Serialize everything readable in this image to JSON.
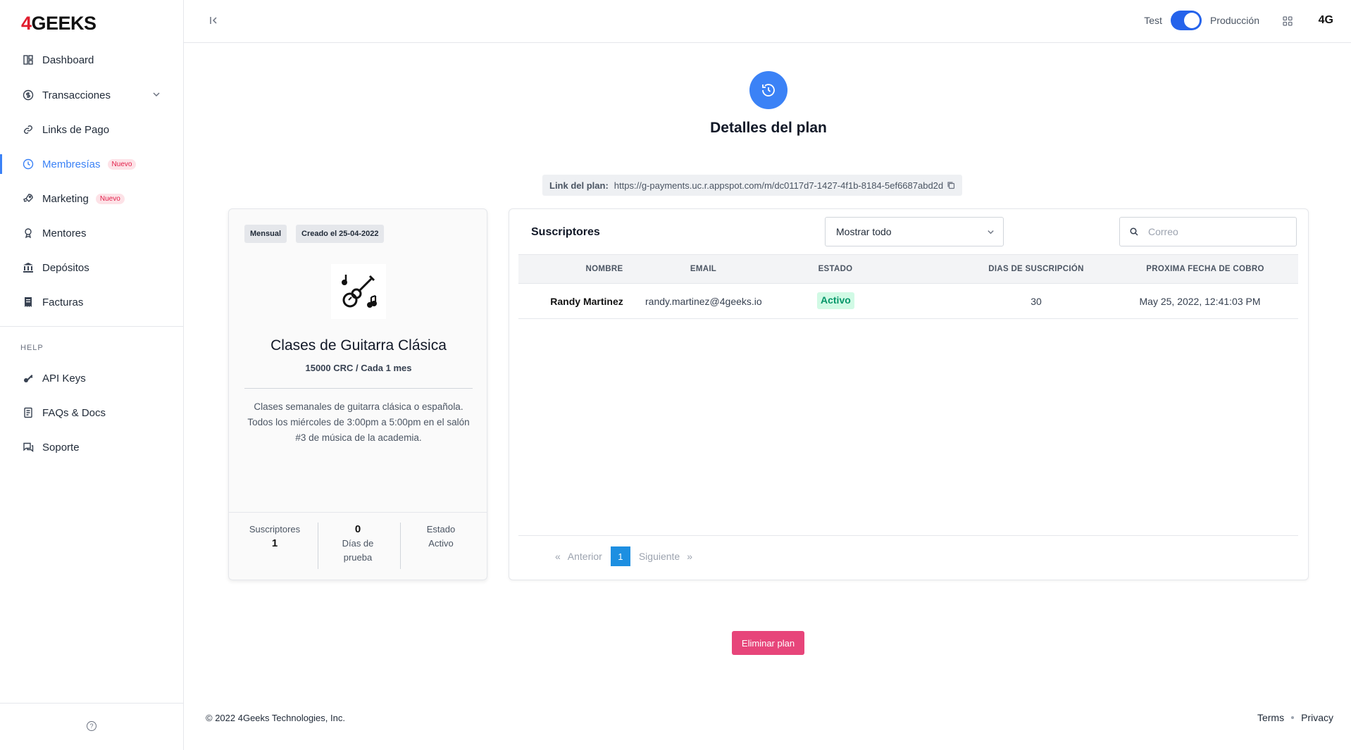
{
  "brand": {
    "logo_prefix": "4",
    "logo_text": "GEEKS"
  },
  "sidebar": {
    "items": [
      {
        "label": "Dashboard",
        "icon": "dashboard-icon"
      },
      {
        "label": "Transacciones",
        "icon": "dollar-icon"
      },
      {
        "label": "Links de Pago",
        "icon": "link-icon"
      },
      {
        "label": "Membresías",
        "icon": "membership-icon",
        "badge": "Nuevo"
      },
      {
        "label": "Marketing",
        "icon": "rocket-icon",
        "badge": "Nuevo"
      },
      {
        "label": "Mentores",
        "icon": "award-icon"
      },
      {
        "label": "Depósitos",
        "icon": "bank-icon"
      },
      {
        "label": "Facturas",
        "icon": "invoice-icon"
      }
    ],
    "help_label": "HELP",
    "help_items": [
      {
        "label": "API Keys",
        "icon": "key-icon"
      },
      {
        "label": "FAQs & Docs",
        "icon": "docs-icon"
      },
      {
        "label": "Soporte",
        "icon": "chat-icon"
      }
    ]
  },
  "topbar": {
    "env_test": "Test",
    "env_prod": "Producción",
    "avatar": "4G"
  },
  "page": {
    "title": "Detalles del plan",
    "link_label": "Link del plan:",
    "link_url": "https://g-payments.uc.r.appspot.com/m/dc0117d7-1427-4f1b-8184-5ef6687abd2d"
  },
  "plan": {
    "tag_frequency": "Mensual",
    "tag_created": "Creado el 25-04-2022",
    "name": "Clases de Guitarra Clásica",
    "price": "15000 CRC / Cada 1 mes",
    "description": "Clases semanales de guitarra clásica o española. Todos los miércoles de 3:00pm a 5:00pm en el salón #3 de música de la academia.",
    "stats": {
      "subs_label": "Suscriptores",
      "subs_value": "1",
      "trial_value": "0",
      "trial_label": "Días de prueba",
      "status_label": "Estado",
      "status_value": "Activo"
    }
  },
  "subscribers": {
    "title": "Suscriptores",
    "filter_value": "Mostrar todo",
    "search_placeholder": "Correo",
    "columns": [
      "NOMBRE",
      "EMAIL",
      "ESTADO",
      "DIAS DE SUSCRIPCIÓN",
      "PROXIMA FECHA DE COBRO"
    ],
    "rows": [
      {
        "name": "Randy Martinez",
        "email": "randy.martinez@4geeks.io",
        "status": "Activo",
        "days": "30",
        "next_charge": "May 25, 2022, 12:41:03 PM"
      }
    ],
    "pager": {
      "prev_arrow": "«",
      "prev": "Anterior",
      "current": "1",
      "next": "Siguiente",
      "next_arrow": "»"
    }
  },
  "actions": {
    "delete": "Eliminar plan"
  },
  "footer": {
    "copyright": "© 2022 4Geeks Technologies, Inc.",
    "terms": "Terms",
    "privacy": "Privacy"
  },
  "colors": {
    "accent": "#3b82f6",
    "danger": "#e7457a",
    "success": "#059669"
  }
}
